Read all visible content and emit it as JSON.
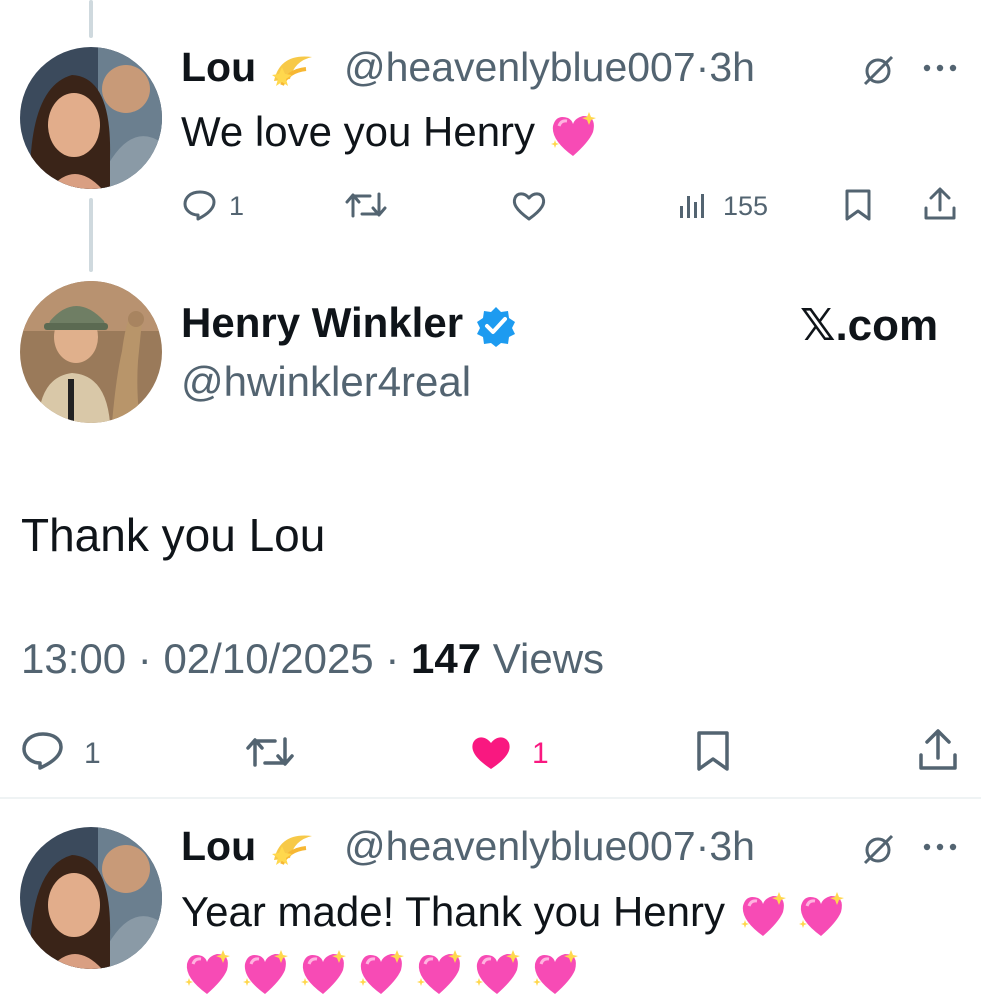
{
  "tweet1": {
    "name": "Lou",
    "name_emoji_icon": "dizzy-star-emoji",
    "handle": "@heavenlyblue007",
    "sep": "·",
    "time": "3h",
    "text": "We love you Henry",
    "text_emoji_icon": "sparkling-heart-emoji",
    "reply_count": "1",
    "views_count": "155"
  },
  "main": {
    "name": "Henry Winkler",
    "handle": "@hwinkler4real",
    "brand": "𝕏.com",
    "text": "Thank you Lou",
    "time": "13:00",
    "date": "02/10/2025",
    "sep": "·",
    "views_count": "147",
    "views_label": "Views",
    "reply_count": "1",
    "like_count": "1",
    "like_color": "#f91880",
    "verified_color": "#1d9bf0"
  },
  "tweet2": {
    "name": "Lou",
    "name_emoji_icon": "dizzy-star-emoji",
    "handle": "@heavenlyblue007",
    "sep": "·",
    "time": "3h",
    "text": "Year made! Thank you Henry",
    "text_emoji_icon": "sparkling-heart-emoji",
    "heart_emoji_count": 9
  }
}
